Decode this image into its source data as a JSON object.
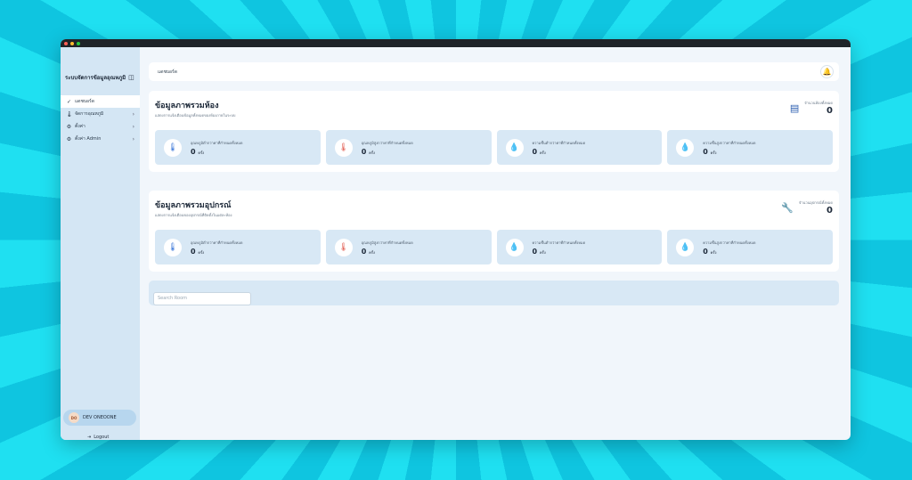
{
  "app": {
    "title": "ระบบจัดการข้อมูลอุณหภูมิ"
  },
  "sidebar": {
    "items": [
      {
        "label": "แดชบอร์ด",
        "icon": "chart-icon",
        "active": true
      },
      {
        "label": "จัดการอุณหภูมิ",
        "icon": "thermometer-icon",
        "has_children": true
      },
      {
        "label": "ตั้งค่า",
        "icon": "gear-icon",
        "has_children": true
      },
      {
        "label": "ตั้งค่า Admin",
        "icon": "gear-icon",
        "has_children": true
      }
    ],
    "user": {
      "initials": "DO",
      "name": "DEV ONEOONE"
    },
    "logout_label": "Logout"
  },
  "topbar": {
    "breadcrumb": "แดชบอร์ด"
  },
  "rooms_card": {
    "title": "ข้อมูลภาพรวมห้อง",
    "subtitle": "แสดงการแจ้งเตือนข้อมูลทั้งหมดของห้องภายในระบบ",
    "total_label": "จำนวนห้องทั้งหมด",
    "total_value": "0",
    "stats": [
      {
        "label": "อุณหภูมิต่ำกว่าค่าที่กำหนดทั้งหมด",
        "value": "0",
        "unit": "ครั้ง",
        "icon": "thermometer-low-icon",
        "color": "#2f6fd6"
      },
      {
        "label": "อุณหภูมิสูงกว่าค่าที่กำหนดทั้งหมด",
        "value": "0",
        "unit": "ครั้ง",
        "icon": "thermometer-high-icon",
        "color": "#e0564a"
      },
      {
        "label": "ความชื้นต่ำกว่าค่าที่กำหนดทั้งหมด",
        "value": "0",
        "unit": "ครั้ง",
        "icon": "droplet-low-icon",
        "color": "#2a9fd8"
      },
      {
        "label": "ความชื้นสูงกว่าค่าที่กำหนดทั้งหมด",
        "value": "0",
        "unit": "ครั้ง",
        "icon": "droplet-high-icon",
        "color": "#7a4ad6"
      }
    ]
  },
  "devices_card": {
    "title": "ข้อมูลภาพรวมอุปกรณ์",
    "subtitle": "แสดงการแจ้งเตือนของอุปกรณ์ที่ติดตั้งในแต่ละห้อง",
    "total_label": "จำนวนอุปกรณ์ทั้งหมด",
    "total_value": "0",
    "stats": [
      {
        "label": "อุณหภูมิต่ำกว่าค่าที่กำหนดทั้งหมด",
        "value": "0",
        "unit": "ครั้ง",
        "icon": "thermometer-low-icon",
        "color": "#2f6fd6"
      },
      {
        "label": "อุณหภูมิสูงกว่าค่าที่กำหนดทั้งหมด",
        "value": "0",
        "unit": "ครั้ง",
        "icon": "thermometer-high-icon",
        "color": "#e0564a"
      },
      {
        "label": "ความชื้นต่ำกว่าค่าที่กำหนดทั้งหมด",
        "value": "0",
        "unit": "ครั้ง",
        "icon": "droplet-low-icon",
        "color": "#2a9fd8"
      },
      {
        "label": "ความชื้นสูงกว่าค่าที่กำหนดทั้งหมด",
        "value": "0",
        "unit": "ครั้ง",
        "icon": "droplet-high-icon",
        "color": "#7a4ad6"
      }
    ]
  },
  "search": {
    "placeholder": "Search Room"
  }
}
